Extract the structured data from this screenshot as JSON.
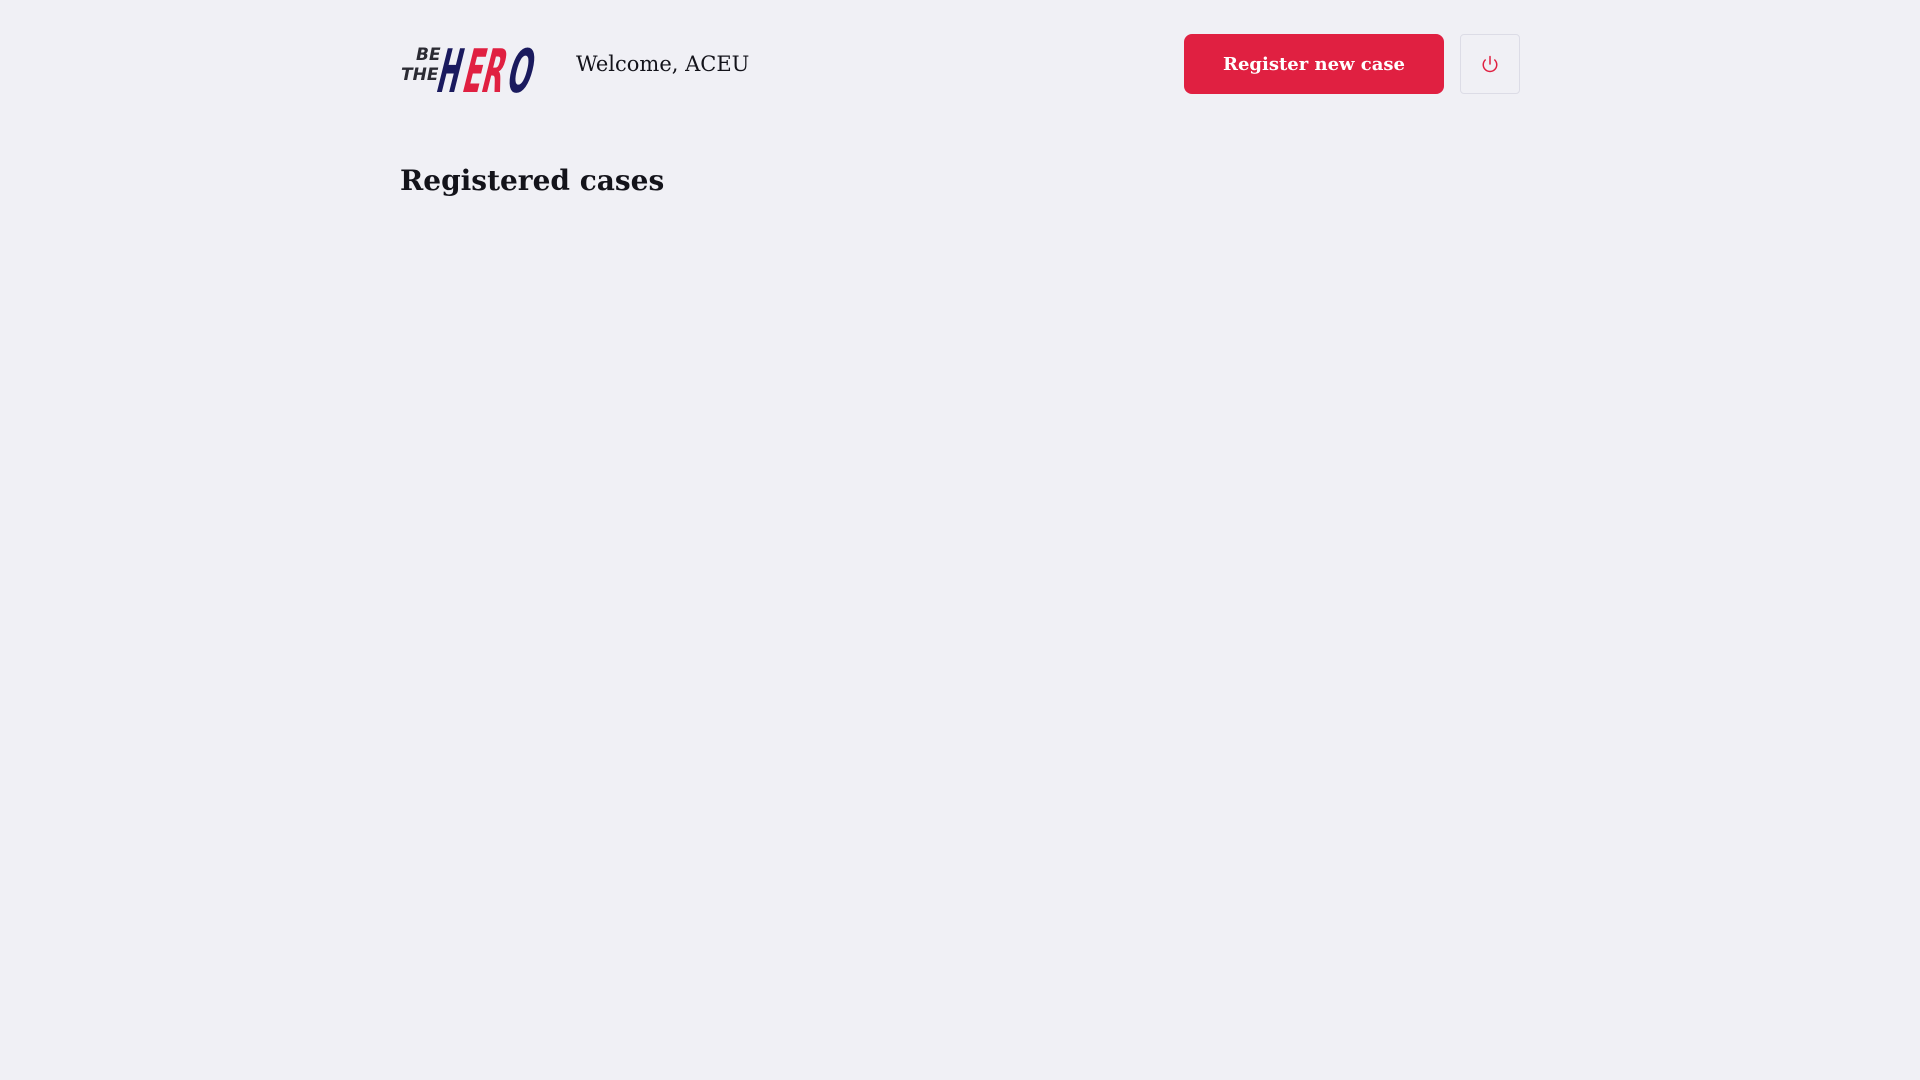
{
  "header": {
    "logo_text": "BE THE HERO",
    "welcome_text": "Welcome, ACEU",
    "register_label": "Register new case",
    "logout_icon": "power-icon"
  },
  "main": {
    "title": "Registered cases"
  },
  "colors": {
    "accent": "#e02041",
    "logo_navy": "#1a1a5e",
    "background": "#f0f0f5",
    "text": "#13131a"
  }
}
